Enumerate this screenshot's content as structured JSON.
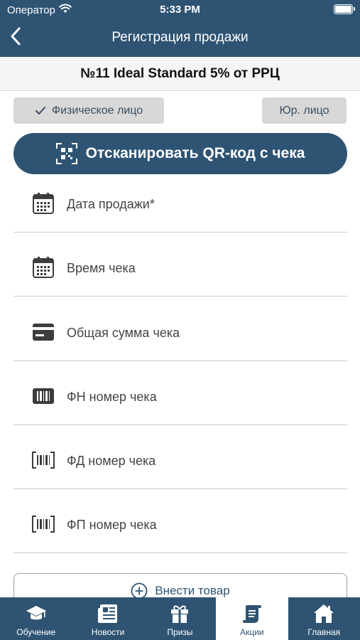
{
  "status_bar": {
    "carrier": "Оператор",
    "time": "5:33 PM"
  },
  "navbar": {
    "title": "Регистрация продажи"
  },
  "promo": {
    "title": "№11 Ideal Standard 5% от РРЦ"
  },
  "segments": {
    "individual": "Физическое лицо",
    "legal": "Юр. лицо",
    "selected": "individual"
  },
  "scan_button": {
    "label": "Отсканировать QR-код с чека"
  },
  "fields": [
    {
      "label": "Дата продажи*",
      "icon": "calendar-icon"
    },
    {
      "label": "Время чека",
      "icon": "calendar-icon"
    },
    {
      "label": "Общая сумма чека",
      "icon": "card-icon"
    },
    {
      "label": "ФН номер чека",
      "icon": "barcode-filled-icon"
    },
    {
      "label": "ФД номер чека",
      "icon": "barcode-icon"
    },
    {
      "label": "ФП номер чека",
      "icon": "barcode-icon"
    }
  ],
  "add_item": {
    "label": "Внести товар"
  },
  "tabs": [
    {
      "label": "Обучение",
      "icon": "graduation-cap-icon"
    },
    {
      "label": "Новости",
      "icon": "newspaper-icon"
    },
    {
      "label": "Призы",
      "icon": "gift-icon"
    },
    {
      "label": "Акции",
      "icon": "scroll-icon",
      "active": true
    },
    {
      "label": "Главная",
      "icon": "home-icon"
    }
  ],
  "colors": {
    "primary": "#2f5473",
    "band": "#f5f5f5",
    "segment": "#d8d8d8"
  }
}
